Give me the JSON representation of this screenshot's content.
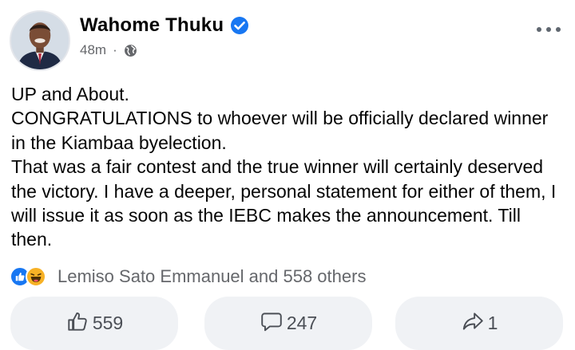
{
  "post": {
    "author": {
      "name": "Wahome Thuku",
      "verified": true,
      "avatar": "avatar-photo"
    },
    "meta": {
      "time": "48m",
      "separator": "·",
      "privacy_icon": "globe-icon"
    },
    "menu_icon": "more-horizontal-icon",
    "body_lines": [
      "UP and About.",
      "CONGRATULATIONS to whoever will be officially declared winner in the Kiambaa byelection.",
      "That was a fair contest and the true winner will certainly deserved the victory. I have a deeper, personal statement for either of them, I will issue it as soon as the IEBC makes the announcement. Till then."
    ],
    "reactions": {
      "icons": [
        "like-reaction-icon",
        "haha-reaction-icon"
      ],
      "text": "Lemiso Sato Emmanuel and 558 others"
    },
    "actions": {
      "like": {
        "icon": "thumbs-up-icon",
        "count": "559"
      },
      "comment": {
        "icon": "comment-icon",
        "count": "247"
      },
      "share": {
        "icon": "share-icon",
        "count": "1"
      }
    },
    "colors": {
      "verified": "#1877f2",
      "secondary_text": "#65676b",
      "button_bg": "#f0f2f5",
      "like_reaction": "#1877f2",
      "haha_reaction": "#f7b125"
    }
  }
}
